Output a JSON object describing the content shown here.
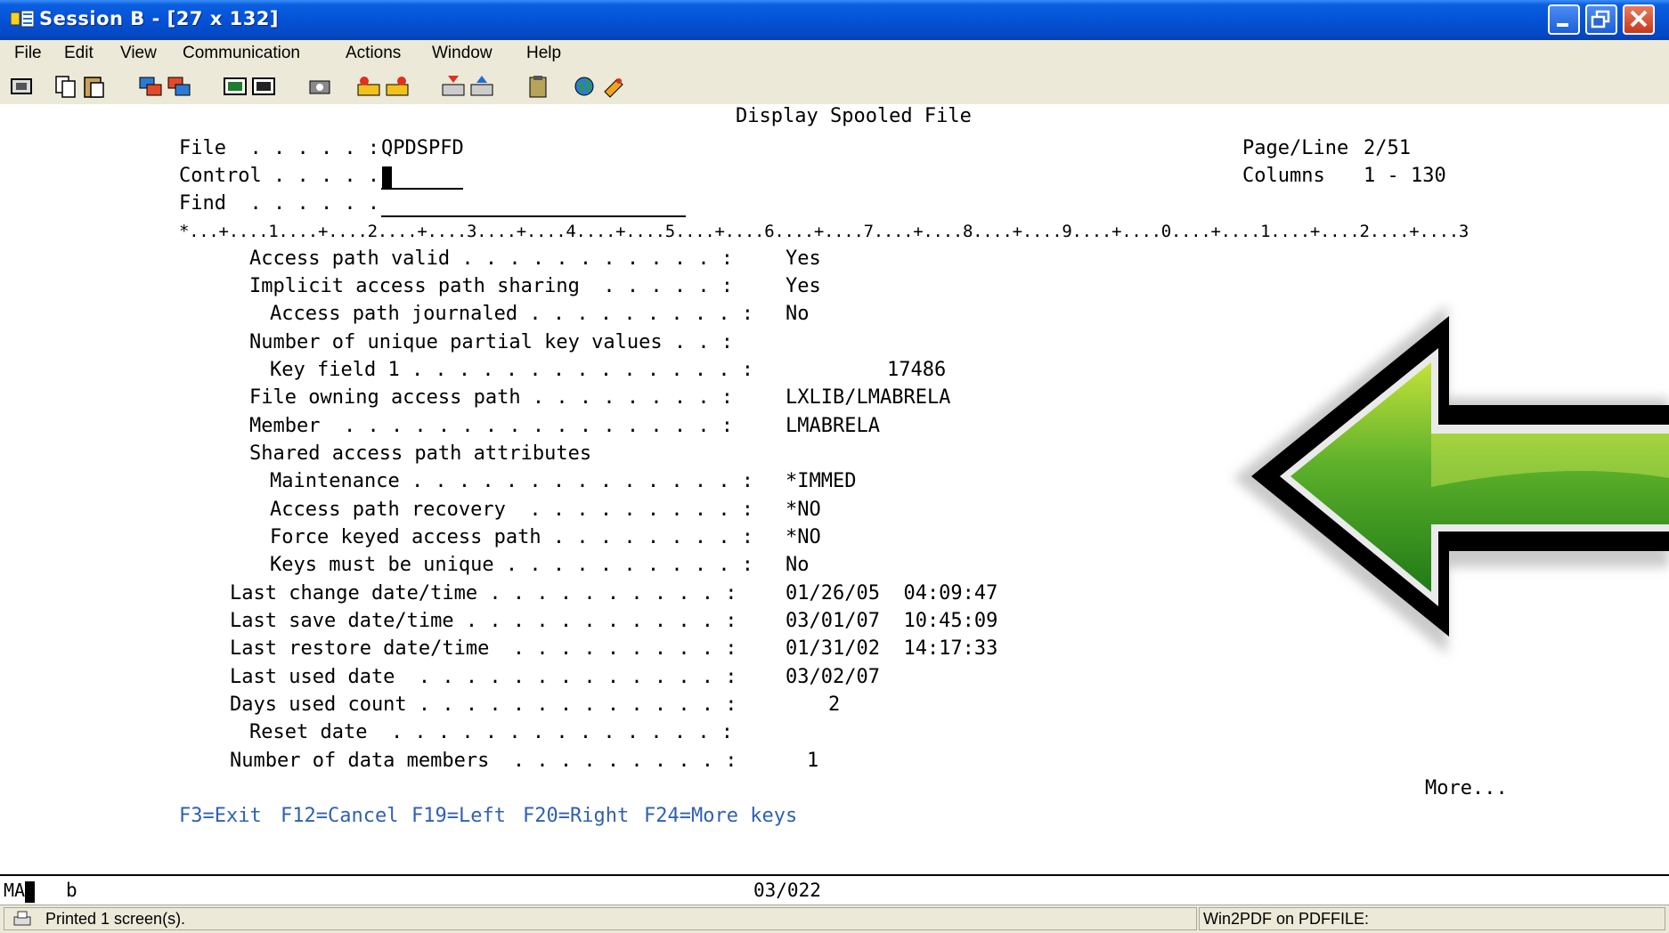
{
  "window": {
    "title": "Session B - [27 x 132]"
  },
  "menu": [
    "File",
    "Edit",
    "View",
    "Communication",
    "Actions",
    "Window",
    "Help"
  ],
  "toolbar_icons": [
    "print-screen-icon",
    "copy-icon",
    "paste-icon",
    "send-file-icon",
    "receive-file-icon",
    "display-icon",
    "keyboard-icon",
    "macro-icon",
    "record-macro-icon",
    "play-macro-icon",
    "transfer-to-host-icon",
    "transfer-from-host-icon",
    "clipboard-icon",
    "globe-icon",
    "settings-icon"
  ],
  "screen": {
    "title": "Display Spooled File",
    "file_label": "File  . . . . . :",
    "file_value": "QPDSPFD",
    "control_label": "Control . . . . .",
    "find_label": "Find  . . . . . .",
    "page_line_label": "Page/Line",
    "page_line_value": "2/51",
    "columns_label": "Columns",
    "columns_value": "1 - 130",
    "ruler": "*...+....1....+....2....+....3....+....4....+....5....+....6....+....7....+....8....+....9....+....0....+....1....+....2....+....3",
    "rows": [
      {
        "label": "Access path valid . . . . . . . . . . . :",
        "value": "Yes"
      },
      {
        "label": "Implicit access path sharing  . . . . . :",
        "value": "Yes"
      },
      {
        "label": "Access path journaled . . . . . . . . . :",
        "value": "No"
      },
      {
        "label": "Number of unique partial key values . . :",
        "value": ""
      },
      {
        "label": "Key field 1 . . . . . . . . . . . . . . :",
        "value": "17486"
      },
      {
        "label": "File owning access path . . . . . . . . :",
        "value": "LXLIB/LMABRELA"
      },
      {
        "label": "Member  . . . . . . . . . . . . . . . . :",
        "value": "LMABRELA"
      },
      {
        "label": "Shared access path attributes",
        "value": ""
      },
      {
        "label": "Maintenance . . . . . . . . . . . . . . :",
        "value": "*IMMED"
      },
      {
        "label": "Access path recovery  . . . . . . . . . :",
        "value": "*NO"
      },
      {
        "label": "Force keyed access path . . . . . . . . :",
        "value": "*NO"
      },
      {
        "label": "Keys must be unique . . . . . . . . . . :",
        "value": "No"
      },
      {
        "label": "Last change date/time . . . . . . . . . . :",
        "value": "01/26/05  04:09:47"
      },
      {
        "label": "Last save date/time . . . . . . . . . . . :",
        "value": "03/01/07  10:45:09"
      },
      {
        "label": "Last restore date/time  . . . . . . . . . :",
        "value": "01/31/02  14:17:33"
      },
      {
        "label": "Last used date  . . . . . . . . . . . . . :",
        "value": "03/02/07"
      },
      {
        "label": "Days used count . . . . . . . . . . . . . :",
        "value": "2"
      },
      {
        "label": "Reset date  . . . . . . . . . . . . . . :",
        "value": ""
      },
      {
        "label": "Number of data members  . . . . . . . . . :",
        "value": "1"
      }
    ],
    "more": "More...",
    "fkeys": [
      "F3=Exit",
      "F12=Cancel",
      "F19=Left",
      "F20=Right",
      "F24=More keys"
    ]
  },
  "oia": {
    "mode": "MA",
    "indicator": "b",
    "cursor_pos": "03/022"
  },
  "statusbar": {
    "message": "Printed 1 screen(s).",
    "printer": "Win2PDF on PDFFILE:"
  },
  "colors": {
    "titlebar": "#0552d6",
    "chrome": "#ece9d8",
    "fkey_text": "#2f61b3",
    "arrow_green": "#3c9e1d"
  }
}
